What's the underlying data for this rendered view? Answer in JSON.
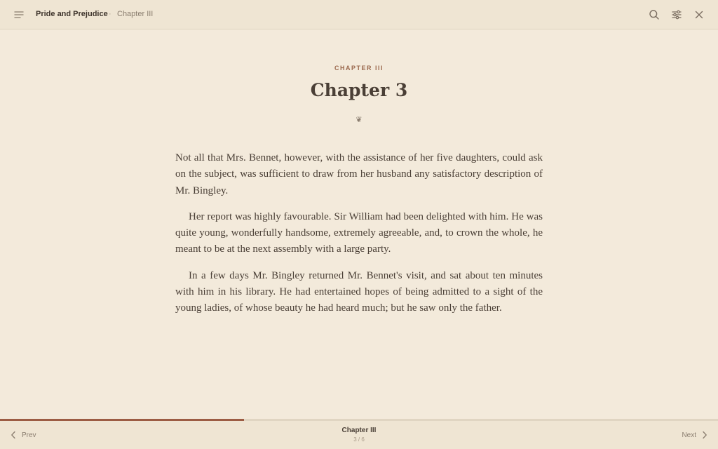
{
  "header": {
    "book_title": "Pride and Prejudice",
    "separator": "·",
    "chapter": "Chapter III",
    "icons": {
      "menu": "menu-icon",
      "search": "search-icon",
      "settings": "sliders-icon",
      "close": "close-icon"
    }
  },
  "chapter": {
    "kicker": "CHAPTER III",
    "title": "Chapter 3",
    "ornament": "❦"
  },
  "paragraphs": [
    "Not all that Mrs. Bennet, however, with the assistance of her five daughters, could ask on the subject, was sufficient to draw from her husband any satisfactory description of Mr. Bingley.",
    "Her report was highly favourable. Sir William had been delighted with him. He was quite young, wonderfully handsome, extremely agreeable, and, to crown the whole, he meant to be at the next assembly with a large party.",
    "In a few days Mr. Bingley returned Mr. Bennet's visit, and sat about ten minutes with him in his library. He had entertained hopes of being admitted to a sight of the young ladies, of whose beauty he had heard much; but he saw only the father."
  ],
  "footer": {
    "prev_label": "Prev",
    "next_label": "Next",
    "chapter": "Chapter III",
    "page_indicator": "3 / 6",
    "progress_fraction": 0.34
  },
  "colors": {
    "background": "#f3eadb",
    "bar": "#efe5d3",
    "accent": "#9c5c43",
    "text": "#4a3f36"
  }
}
